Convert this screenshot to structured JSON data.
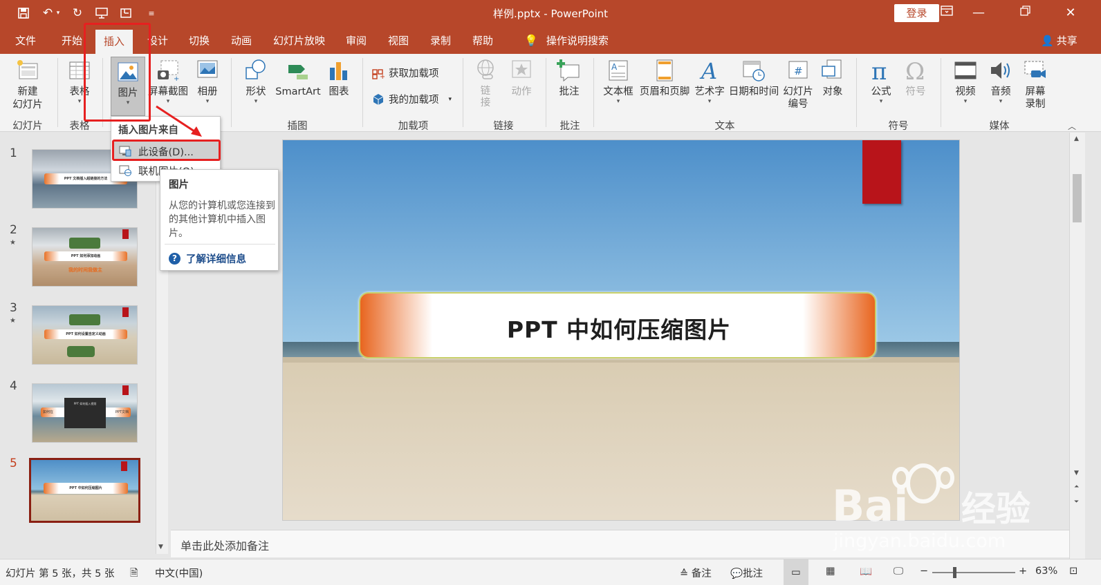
{
  "window": {
    "title": "样例.pptx  -  PowerPoint",
    "login_label": "登录"
  },
  "tabs": [
    "文件",
    "开始",
    "插入",
    "设计",
    "切换",
    "动画",
    "幻灯片放映",
    "审阅",
    "视图",
    "录制",
    "帮助"
  ],
  "active_tab": "插入",
  "tell_me": "操作说明搜索",
  "share": "共享",
  "ribbon": {
    "new_slide": "新建\n幻灯片",
    "table": "表格",
    "pictures": "图片",
    "screenshot": "屏幕截图",
    "album": "相册",
    "shapes": "形状",
    "smartart": "SmartArt",
    "chart": "图表",
    "get_addins": "获取加载项",
    "my_addins": "我的加载项",
    "link": "链\n接",
    "action": "动作",
    "comment": "批注",
    "textbox": "文本框",
    "header_footer": "页眉和页脚",
    "wordart": "艺术字",
    "date_time": "日期和时间",
    "slide_number": "幻灯片\n编号",
    "object": "对象",
    "equation": "公式",
    "symbol": "符号",
    "video": "视频",
    "audio": "音频",
    "screen_recording": "屏幕\n录制",
    "groups": {
      "slides": "幻灯片",
      "tables": "表格",
      "illustrations": "插图",
      "addins": "加载项",
      "links": "链接",
      "comments": "批注",
      "text": "文本",
      "symbols": "符号",
      "media": "媒体"
    }
  },
  "dropdown": {
    "header": "插入图片来自",
    "items": [
      "此设备(D)...",
      "联机图片(O)..."
    ]
  },
  "tooltip": {
    "title": "图片",
    "body": "从您的计算机或您连接到的其他计算机中插入图片。",
    "link": "了解详细信息"
  },
  "thumbnails": [
    {
      "number": "1",
      "caption": "PPT 文档插入超链接的方法"
    },
    {
      "number": "2",
      "caption": "PPT 如何添加动画",
      "subtitle": "我的时间我做主"
    },
    {
      "number": "3",
      "caption": "PPT 如何设置自定义动画"
    },
    {
      "number": "4",
      "caption": "PPT 如何插入视频",
      "left_text": "如何在",
      "right_text": "PPT文档"
    },
    {
      "number": "5",
      "caption": "PPT 中如何压缩图片"
    }
  ],
  "current_slide": {
    "number": "5",
    "title": "PPT 中如何压缩图片"
  },
  "notes_placeholder": "单击此处添加备注",
  "status": {
    "slide_info": "幻灯片 第 5 张，共 5 张",
    "language": "中文(中国)",
    "notes": "备注",
    "comments": "批注",
    "zoom": "63%"
  },
  "watermark": {
    "brand": "Baidu经验",
    "url": "jingyan.baidu.com"
  },
  "colors": {
    "accent": "#b7472a",
    "highlight": "#e62020",
    "ribbon_bg": "#f3f3f3"
  }
}
